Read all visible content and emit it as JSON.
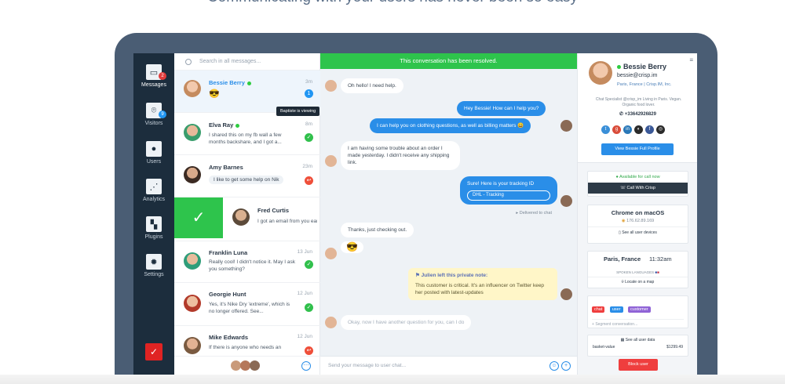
{
  "headline": "Communicating with your users has never been so easy",
  "nav": {
    "items": [
      {
        "label": "Messages",
        "badge": "2"
      },
      {
        "label": "Visitors",
        "badge": "9"
      },
      {
        "label": "Users"
      },
      {
        "label": "Analytics"
      },
      {
        "label": "Plugins"
      },
      {
        "label": "Settings"
      }
    ]
  },
  "search": {
    "placeholder": "Search in all messages..."
  },
  "conversations": [
    {
      "name": "Bessie Berry",
      "time": "3m",
      "preview": "😎",
      "badge": "1"
    },
    {
      "name": "Elva Ray",
      "time": "8m",
      "preview": "I shared this on my fb wall a few months backshare, and I got a..."
    },
    {
      "name": "Amy Barnes",
      "time": "23m",
      "preview": "I like to get some help on Nik"
    },
    {
      "name": "Fred Curtis",
      "time": "",
      "preview": "I got an email from you earlier this link. When does this prom"
    },
    {
      "name": "Franklin Luna",
      "time": "13 Jun",
      "preview": "Really cool! I didn't notice it. May I ask you something?"
    },
    {
      "name": "Georgie Hunt",
      "time": "12 Jun",
      "preview": "Yes, it's Nike Dry 'extreme', which is no longer offered. See..."
    },
    {
      "name": "Mike Edwards",
      "time": "12 Jun",
      "preview": "If there is anyone who needs an"
    }
  ],
  "tooltip": "Baptiste is viewing",
  "chat": {
    "resolved": "This conversation has been resolved.",
    "messages": [
      {
        "text": "Oh hello! I need help."
      },
      {
        "text": "Hey Bessie! How can I help you?"
      },
      {
        "text": "I can help you on clothing questions, as well as billing matters 😀"
      },
      {
        "text": "I am having some trouble about an order I made yesterday. I didn't receive any shipping link."
      },
      {
        "text": "Sure! Here is your tracking ID",
        "link": "DHL - Tracking"
      },
      {
        "text": "Thanks, just checking out."
      },
      {
        "text": "😎"
      }
    ],
    "delivered": "Delivered to chat",
    "note_title": "Julien left this private note:",
    "note_text": "This customer is critical. It's an influencer on Twitter keep her posted with latest-updates",
    "draft": "Okay, now I have another question for you, can I do",
    "input_placeholder": "Send your message to user chat..."
  },
  "profile": {
    "name": "Bessie Berry",
    "email": "bessie@crisp.im",
    "location": "Paris, France | Crisp.IM, Inc.",
    "bio": "Chat Specialist @crisp_im Living in Paris. Vegan. Organic food lover.",
    "phone": "+33642926829",
    "full_profile": "View Bessie Full Profile",
    "available": "Available for call now",
    "call": "Call With Crisp",
    "browser": "Chrome on macOS",
    "ip": "176.62.89.169",
    "devices": "See all user devices",
    "city": "Paris, France",
    "local_time": "11:32am",
    "languages": "SPOKEN LANGUAGES",
    "map": "Locate on a map",
    "tags": [
      "chat",
      "user",
      "customer"
    ],
    "segment_placeholder": "Segment conversation...",
    "user_data": "See all user data",
    "data_key": "basket-value",
    "data_value": "$1299.49",
    "block": "Block user"
  },
  "colors": {
    "green": "#2ec44c",
    "blue": "#2a8ee8",
    "nav": "#1c2d3d",
    "red": "#ef3e3e"
  }
}
